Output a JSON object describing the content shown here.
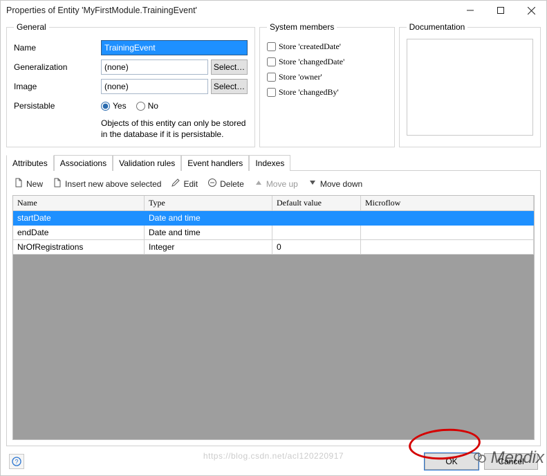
{
  "window": {
    "title": "Properties of Entity 'MyFirstModule.TrainingEvent'"
  },
  "general": {
    "legend": "General",
    "nameLabel": "Name",
    "nameValue": "TrainingEvent",
    "genLabel": "Generalization",
    "genValue": "(none)",
    "imageLabel": "Image",
    "imageValue": "(none)",
    "selectLabel": "Select…",
    "persistLabel": "Persistable",
    "yesLabel": "Yes",
    "noLabel": "No",
    "helpText": "Objects of this entity can only be stored in the database if it is persistable."
  },
  "system": {
    "legend": "System members",
    "items": [
      "Store 'createdDate'",
      "Store 'changedDate'",
      "Store 'owner'",
      "Store 'changedBy'"
    ]
  },
  "documentation": {
    "legend": "Documentation",
    "value": ""
  },
  "tabs": {
    "attributes": "Attributes",
    "associations": "Associations",
    "validation": "Validation rules",
    "eventHandlers": "Event handlers",
    "indexes": "Indexes"
  },
  "toolbar": {
    "new": "New",
    "insert": "Insert new above selected",
    "edit": "Edit",
    "delete": "Delete",
    "moveUp": "Move up",
    "moveDown": "Move down"
  },
  "grid": {
    "headers": {
      "name": "Name",
      "type": "Type",
      "default": "Default value",
      "microflow": "Microflow"
    },
    "rows": [
      {
        "name": "startDate",
        "type": "Date and time",
        "default": "",
        "microflow": ""
      },
      {
        "name": "endDate",
        "type": "Date and time",
        "default": "",
        "microflow": ""
      },
      {
        "name": "NrOfRegistrations",
        "type": "Integer",
        "default": "0",
        "microflow": ""
      }
    ]
  },
  "footer": {
    "ok": "OK",
    "cancel": "Cancel"
  },
  "watermark": "Mendix"
}
